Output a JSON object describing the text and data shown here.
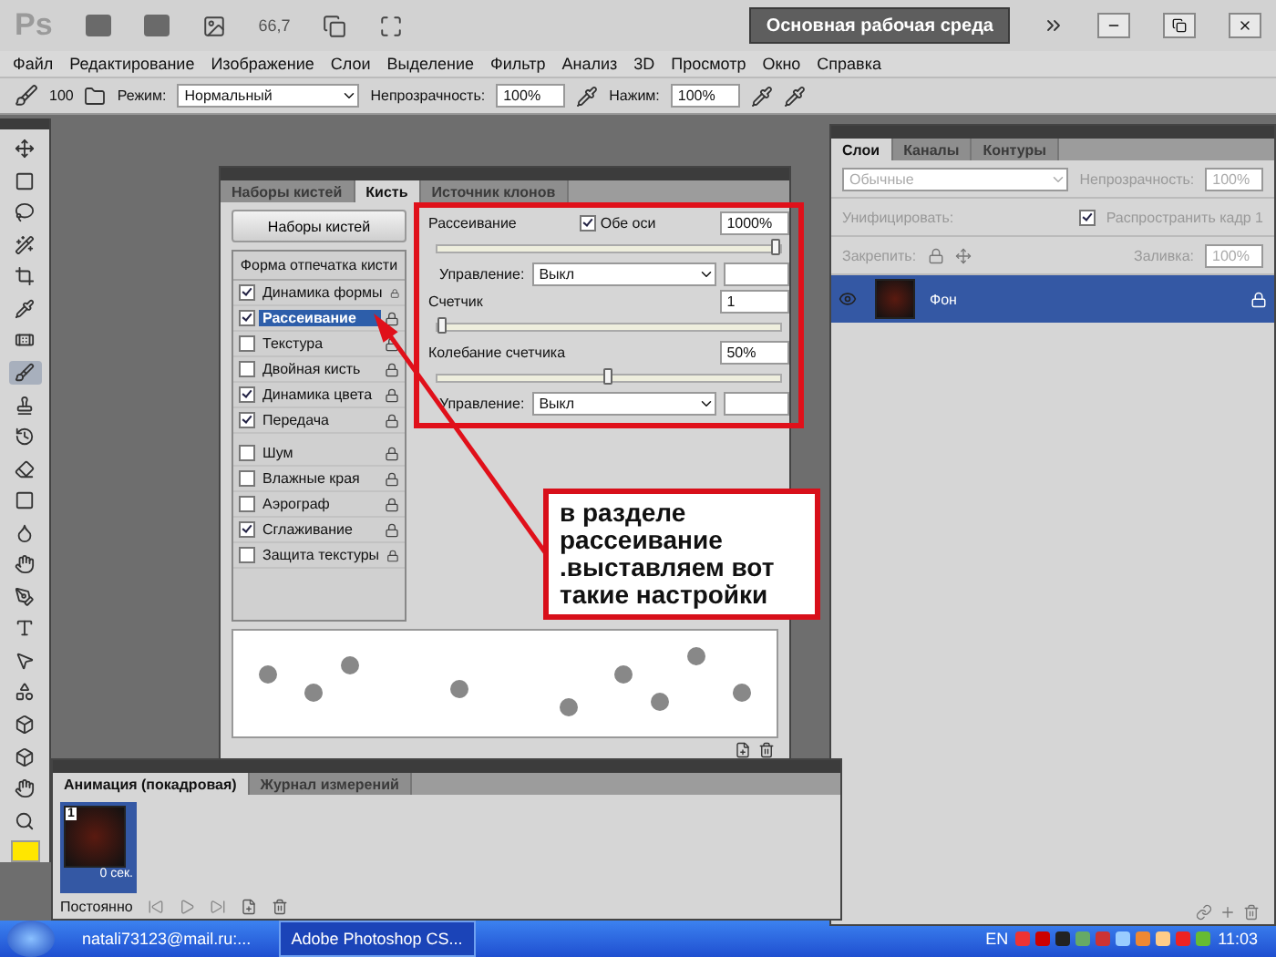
{
  "app_bar": {
    "logo": "Ps",
    "zoom": "66,7",
    "workspace_button": "Основная рабочая среда"
  },
  "menu": [
    "Файл",
    "Редактирование",
    "Изображение",
    "Слои",
    "Выделение",
    "Фильтр",
    "Анализ",
    "3D",
    "Просмотр",
    "Окно",
    "Справка"
  ],
  "options_bar": {
    "brush_size": "100",
    "mode_label": "Режим:",
    "mode_value": "Нормальный",
    "opacity_label": "Непрозрачность:",
    "opacity_value": "100%",
    "pressure_label": "Нажим:",
    "pressure_value": "100%"
  },
  "brush_panel": {
    "tabs": [
      {
        "label": "Наборы кистей",
        "selected": false
      },
      {
        "label": "Кисть",
        "selected": true
      },
      {
        "label": "Источник клонов",
        "selected": false
      }
    ],
    "presets_button": "Наборы кистей",
    "section_title": "Форма отпечатка кисти",
    "items": [
      {
        "label": "Динамика формы",
        "checked": true,
        "selected": false
      },
      {
        "label": "Рассеивание",
        "checked": true,
        "selected": true
      },
      {
        "label": "Текстура",
        "checked": false,
        "selected": false
      },
      {
        "label": "Двойная кисть",
        "checked": false,
        "selected": false
      },
      {
        "label": "Динамика цвета",
        "checked": true,
        "selected": false
      },
      {
        "label": "Передача",
        "checked": true,
        "selected": false
      },
      {
        "label": "Шум",
        "checked": false,
        "selected": false
      },
      {
        "label": "Влажные края",
        "checked": false,
        "selected": false
      },
      {
        "label": "Аэрограф",
        "checked": false,
        "selected": false
      },
      {
        "label": "Сглаживание",
        "checked": true,
        "selected": false
      },
      {
        "label": "Защита текстуры",
        "checked": false,
        "selected": false
      }
    ],
    "scatter": {
      "label": "Рассеивание",
      "both_axes": {
        "label": "Обе оси",
        "checked": true
      },
      "value": "1000%",
      "level": 1
    },
    "scatter_control": {
      "label": "Управление:",
      "value": "Выкл"
    },
    "count": {
      "label": "Счетчик",
      "value": "1",
      "level": 0
    },
    "count_jitter": {
      "label": "Колебание счетчика",
      "value": "50%",
      "level": 0.5
    },
    "count_control": {
      "label": "Управление:",
      "value": "Выкл"
    }
  },
  "callout": [
    "в разделе",
    "рассеивание",
    ".выставляем вот",
    "такие настройки"
  ],
  "layers_panel": {
    "tabs": [
      {
        "label": "Слои",
        "selected": true
      },
      {
        "label": "Каналы",
        "selected": false
      },
      {
        "label": "Контуры",
        "selected": false
      }
    ],
    "blend_mode": "Обычные",
    "opacity_label": "Непрозрачность:",
    "opacity_value": "100%",
    "unify_label": "Унифицировать:",
    "propagate": {
      "label": "Распространить кадр 1",
      "checked": true
    },
    "lock_label": "Закрепить:",
    "fill_label": "Заливка:",
    "fill_value": "100%",
    "layers": [
      {
        "name": "Фон",
        "visible": true,
        "selected": true
      }
    ]
  },
  "animation_panel": {
    "tabs": [
      {
        "label": "Анимация (покадровая)",
        "selected": true
      },
      {
        "label": "Журнал измерений",
        "selected": false
      }
    ],
    "frames": [
      {
        "number": "1",
        "delay": "0 сек.",
        "selected": true
      }
    ],
    "loop": "Постоянно"
  },
  "taskbar": {
    "windows": [
      {
        "label": "natali73123@mail.ru:...",
        "active": false
      },
      {
        "label": "Adobe Photoshop CS...",
        "active": true
      }
    ],
    "language": "EN",
    "time": "11:03"
  }
}
